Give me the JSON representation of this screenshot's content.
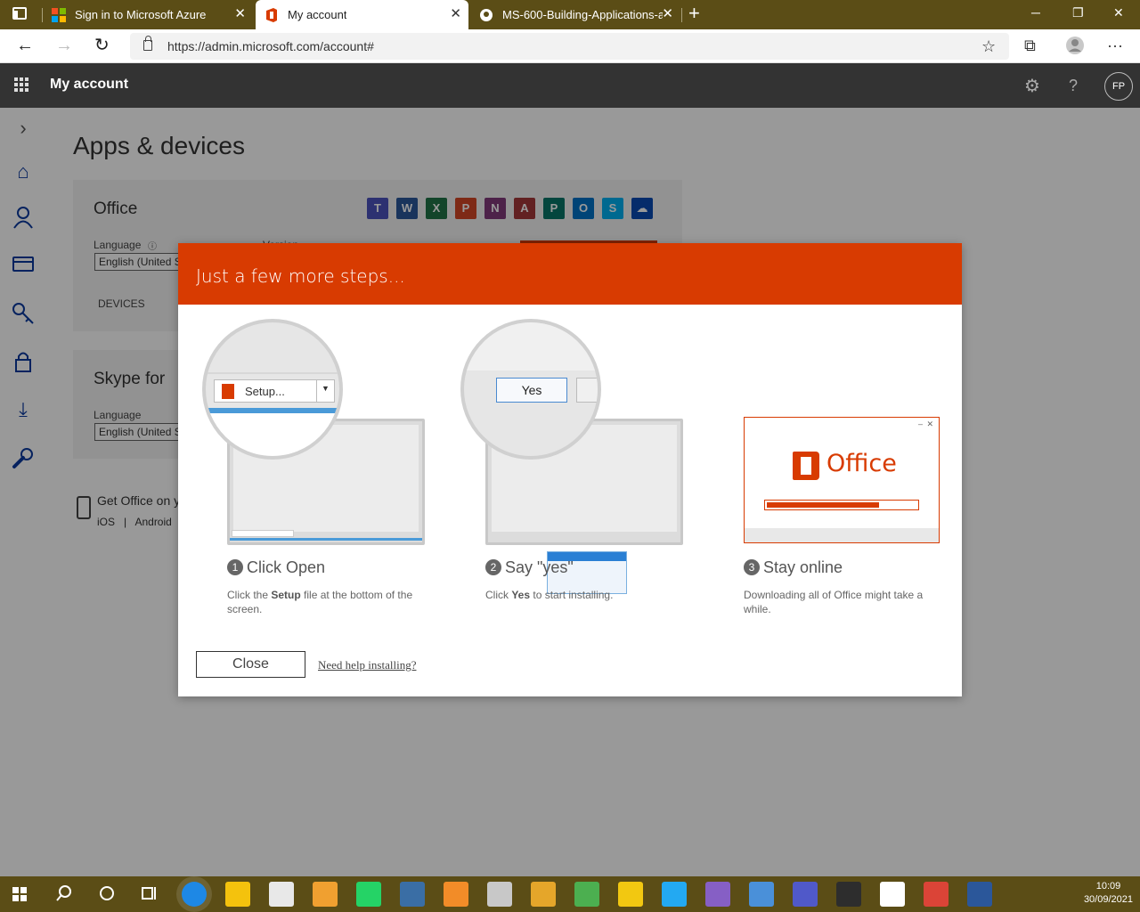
{
  "browser": {
    "tabs": [
      {
        "title": "Sign in to Microsoft Azure",
        "active": false
      },
      {
        "title": "My account",
        "active": true
      },
      {
        "title": "MS-600-Building-Applications-a",
        "active": false
      }
    ],
    "url": "https://admin.microsoft.com/account#"
  },
  "header": {
    "app_title": "My account",
    "avatar_initials": "FP"
  },
  "page": {
    "heading": "Apps & devices",
    "office_card": {
      "title": "Office",
      "language_label": "Language",
      "language_value": "English (United S",
      "version_label": "Version",
      "devices_label": "DEVICES",
      "app_tiles": [
        {
          "letter": "T",
          "color": "#4b53bc"
        },
        {
          "letter": "W",
          "color": "#2b579a"
        },
        {
          "letter": "X",
          "color": "#217346"
        },
        {
          "letter": "P",
          "color": "#d24726"
        },
        {
          "letter": "N",
          "color": "#80397b"
        },
        {
          "letter": "A",
          "color": "#a4373a"
        },
        {
          "letter": "P",
          "color": "#077568"
        },
        {
          "letter": "O",
          "color": "#0072c6"
        },
        {
          "letter": "S",
          "color": "#00aff0"
        },
        {
          "letter": "☁",
          "color": "#094ab2"
        }
      ]
    },
    "skype_card": {
      "title": "Skype for",
      "language_label": "Language",
      "language_value": "English (United S"
    },
    "get_office": {
      "text": "Get Office on y",
      "links": "iOS   |   Android"
    }
  },
  "dialog": {
    "title": "Just a few more steps...",
    "steps": [
      {
        "number": "1",
        "heading": "Click Open",
        "desc_prefix": "Click the ",
        "desc_bold": "Setup",
        "desc_suffix": " file at the bottom of the screen.",
        "callout_label": "Setup..."
      },
      {
        "number": "2",
        "heading": "Say \"yes\"",
        "desc_prefix": "Click ",
        "desc_bold": "Yes",
        "desc_suffix": " to start installing.",
        "callout_label": "Yes"
      },
      {
        "number": "3",
        "heading": "Stay online",
        "desc_prefix": "Downloading all of Office might take a while.",
        "desc_bold": "",
        "desc_suffix": "",
        "brand": "Office",
        "progress": 0.75
      }
    ],
    "close_label": "Close",
    "help_label": "Need help installing?"
  },
  "taskbar": {
    "time": "10:09",
    "date": "30/09/2021",
    "apps": [
      {
        "name": "edge-icon",
        "color": "#1e88e5"
      },
      {
        "name": "file-explorer-icon",
        "color": "#f4c20d"
      },
      {
        "name": "store-icon",
        "color": "#e8e8e8"
      },
      {
        "name": "media-icon",
        "color": "#f0a030"
      },
      {
        "name": "whatsapp-icon",
        "color": "#25d366"
      },
      {
        "name": "vmware-icon",
        "color": "#3a6ea5"
      },
      {
        "name": "notes-icon",
        "color": "#f28c28"
      },
      {
        "name": "paint-icon",
        "color": "#c8c8c8"
      },
      {
        "name": "pin-icon",
        "color": "#e5a62a"
      },
      {
        "name": "terminal-green-icon",
        "color": "#4caf50"
      },
      {
        "name": "powerbi-icon",
        "color": "#f2c811"
      },
      {
        "name": "vscode-icon",
        "color": "#23a9f2"
      },
      {
        "name": "visual-studio-icon",
        "color": "#865fc5"
      },
      {
        "name": "photos-icon",
        "color": "#4a90d9"
      },
      {
        "name": "teams-icon",
        "color": "#5059c9"
      },
      {
        "name": "terminal-icon",
        "color": "#2d2d2d"
      },
      {
        "name": "typora-icon",
        "color": "#ffffff"
      },
      {
        "name": "chrome-icon",
        "color": "#db4437"
      },
      {
        "name": "word-icon",
        "color": "#2b579a"
      }
    ]
  }
}
